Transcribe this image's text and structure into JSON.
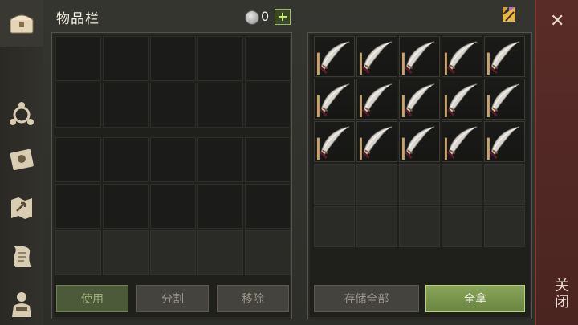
{
  "header": {
    "title": "物品栏",
    "currency_value": "0",
    "add_symbol": "+"
  },
  "left_panel": {
    "buttons": {
      "use": "使用",
      "split": "分割",
      "remove": "移除"
    }
  },
  "right_panel": {
    "item_name": "scimitar",
    "item_count": 15,
    "buttons": {
      "store_all": "存储全部",
      "take_all": "全拿"
    }
  },
  "close": {
    "label": "关闭",
    "x": "✕"
  },
  "rail_icons": [
    "chest-icon",
    "skills-icon",
    "journal-icon",
    "map-icon",
    "scroll-icon",
    "character-icon"
  ],
  "colors": {
    "accent_green": "#7d9a50",
    "close_red": "#5a2c28"
  }
}
